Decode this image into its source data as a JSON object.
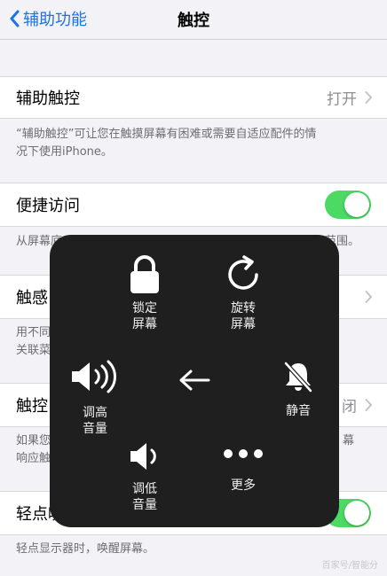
{
  "nav": {
    "back_label": "辅助功能",
    "title": "触控"
  },
  "rows": {
    "assistive_touch": {
      "label": "辅助触控",
      "value": "打开"
    },
    "assistive_touch_footer_line1": "“辅助触控”可让您在触摸屏幕有困难或需要自适应配件的情",
    "assistive_touch_footer_line2": "况下使用iPhone。",
    "reachability": {
      "label": "便捷访问"
    },
    "reachability_footer_left": "从屏幕底",
    "reachability_footer_right": "范围。",
    "haptic": {
      "label": "触感"
    },
    "haptic_footer_line1": "用不同",
    "haptic_footer_line2": "关联菜",
    "touch_accommodations": {
      "label": "触控",
      "value": "闭"
    },
    "touch_footer_line1_left": "如果您",
    "touch_footer_line1_right": "幕",
    "touch_footer_line2_left": "响应触",
    "tap_to_wake": {
      "label": "轻点唤"
    },
    "tap_footer": "轻点显示器时，唤醒屏幕。"
  },
  "menu": {
    "lock": {
      "line1": "锁定",
      "line2": "屏幕"
    },
    "rotate": {
      "line1": "旋转",
      "line2": "屏幕"
    },
    "volume_up": {
      "line1": "调高",
      "line2": "音量"
    },
    "mute": {
      "line1": "静音"
    },
    "volume_down": {
      "line1": "调低",
      "line2": "音量"
    },
    "more": {
      "line1": "更多"
    }
  },
  "watermark": "百家号/智能分",
  "colors": {
    "accent": "#1a73e8",
    "toggle_on": "#4cd964",
    "panel": "#1f1f1f"
  }
}
